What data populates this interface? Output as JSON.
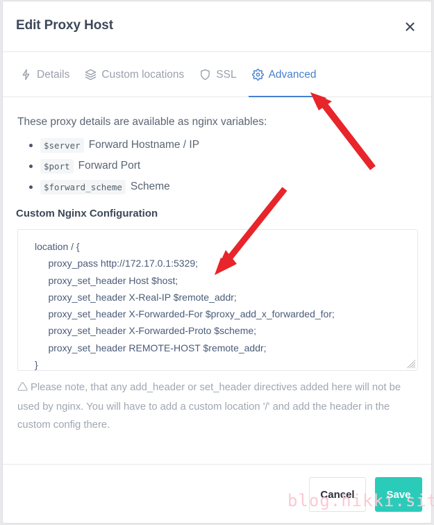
{
  "window": {
    "title": "Edit Proxy Host",
    "close_icon": "close-icon"
  },
  "tabs": [
    {
      "label": "Details",
      "icon": "lightning-bolt-icon",
      "active": false
    },
    {
      "label": "Custom locations",
      "icon": "layers-icon",
      "active": false
    },
    {
      "label": "SSL",
      "icon": "shield-icon",
      "active": false
    },
    {
      "label": "Advanced",
      "icon": "gear-icon",
      "active": true
    }
  ],
  "body": {
    "intro": "These proxy details are available as nginx variables:",
    "variables": [
      {
        "name": "$server",
        "description": "Forward Hostname / IP"
      },
      {
        "name": "$port",
        "description": "Forward Port"
      },
      {
        "name": "$forward_scheme",
        "description": "Scheme"
      }
    ],
    "config_label": "Custom Nginx Configuration",
    "config_value": "location / {\n     proxy_pass http://172.17.0.1:5329;\n     proxy_set_header Host $host;\n     proxy_set_header X-Real-IP $remote_addr;\n     proxy_set_header X-Forwarded-For $proxy_add_x_forwarded_for;\n     proxy_set_header X-Forwarded-Proto $scheme;\n     proxy_set_header REMOTE-HOST $remote_addr;\n}",
    "config_placeholder": "Custom Nginx Configuration",
    "note_icon": "warning-triangle-icon",
    "note": "Please note, that any add_header or set_header directives added here will not be used by nginx. You will have to add a custom location '/' and add the header in the custom config there."
  },
  "footer": {
    "cancel_label": "Cancel",
    "save_label": "Save"
  },
  "watermark": {
    "text": "blog.hikki.site"
  },
  "colors": {
    "accent_blue": "#467fcf",
    "save_teal": "#2bcbba",
    "muted_text": "#9aa0ad",
    "heading": "#3c4858",
    "annotation_red": "#e8252a",
    "watermark_pink": "#fbc9d4"
  },
  "annotations": [
    {
      "name": "arrow-to-advanced-tab",
      "points_to": "Advanced"
    },
    {
      "name": "arrow-to-proxy-pass-line",
      "points_to": "proxy_pass http://172.17.0.1:5329;"
    }
  ]
}
